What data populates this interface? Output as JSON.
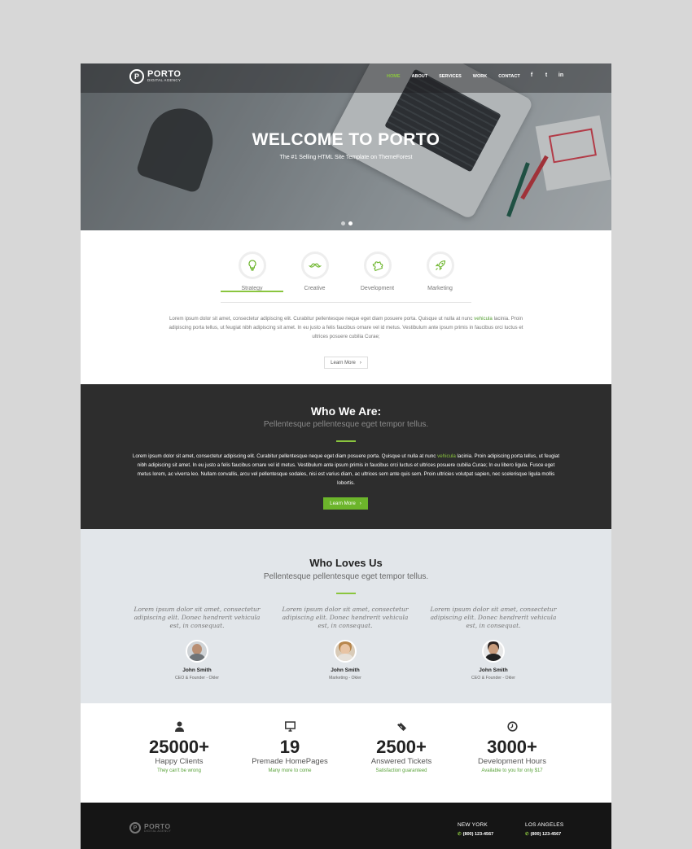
{
  "brand": {
    "name": "PORTO",
    "tagline": "DIGITAL AGENCY",
    "logo_letter": "P"
  },
  "nav": {
    "items": [
      {
        "label": "HOME",
        "active": true
      },
      {
        "label": "ABOUT",
        "active": false
      },
      {
        "label": "SERVICES",
        "active": false
      },
      {
        "label": "WORK",
        "active": false
      },
      {
        "label": "CONTACT",
        "active": false
      }
    ],
    "socials": [
      {
        "icon": "facebook-icon",
        "glyph": "f"
      },
      {
        "icon": "twitter-icon",
        "glyph": "t"
      },
      {
        "icon": "linkedin-icon",
        "glyph": "in"
      }
    ]
  },
  "hero": {
    "title": "WELCOME TO PORTO",
    "subtitle": "The #1 Selling HTML Site Template on ThemeForest"
  },
  "features": {
    "tabs": [
      {
        "label": "Strategy",
        "icon": "lightbulb-icon",
        "active": true
      },
      {
        "label": "Creative",
        "icon": "mustache-icon",
        "active": false
      },
      {
        "label": "Development",
        "icon": "puzzle-icon",
        "active": false
      },
      {
        "label": "Marketing",
        "icon": "rocket-icon",
        "active": false
      }
    ],
    "text_before": "Lorem ipsum dolor sit amet, consectetur adipiscing elit. Curabitur pellentesque neque eget diam posuere porta. Quisque ut nulla at nunc ",
    "link": "vehicula",
    "text_after": " lacinia. Proin adipiscing porta tellus, ut feugiat nibh adipiscing sit amet. In eu justo a felis faucibus ornare vel id metus. Vestibulum ante ipsum primis in faucibus orci luctus et ultrices posuere cubilia Curae;",
    "button": "Learn More",
    "button_arrow": "›"
  },
  "who_we_are": {
    "title": "Who We Are:",
    "subtitle": "Pellentesque pellentesque eget tempor tellus.",
    "text_before": "Lorem ipsum dolor sit amet, consectetur adipiscing elit. Curabitur pellentesque neque eget diam posuere porta. Quisque ut nulla at nunc ",
    "link": "vehicula",
    "text_after": " lacinia. Proin adipiscing porta tellus, ut feugiat nibh adipiscing sit amet. In eu justo a felis faucibus ornare vel id metus. Vestibulum ante ipsum primis in faucibus orci luctus et ultrices posuere cubilia Curae; In eu libero ligula. Fusce eget metus lorem, ac viverra leo. Nullam convallis, arcu vel pellentesque sodales, nisi est varius diam, ac ultrices sem ante quis sem. Proin ultricies volutpat sapien, nec scelerisque ligula mollis lobortis.",
    "button": "Learn More",
    "button_arrow": "›"
  },
  "who_loves_us": {
    "title": "Who Loves Us",
    "subtitle": "Pellentesque pellentesque eget tempor tellus.",
    "testimonials": [
      {
        "quote": "Lorem ipsum dolor sit amet, consectetur adipiscing elit. Donec hendrerit vehicula est, in consequat.",
        "name": "John Smith",
        "role": "CEO & Founder - Okler"
      },
      {
        "quote": "Lorem ipsum dolor sit amet, consectetur adipiscing elit. Donec hendrerit vehicula est, in consequat.",
        "name": "John Smith",
        "role": "Marketing - Okler"
      },
      {
        "quote": "Lorem ipsum dolor sit amet, consectetur adipiscing elit. Donec hendrerit vehicula est, in consequat.",
        "name": "John Smith",
        "role": "CEO & Founder - Okler"
      }
    ]
  },
  "counters": [
    {
      "icon": "user-icon",
      "number": "25000+",
      "label": "Happy Clients",
      "sub": "They can't be wrong"
    },
    {
      "icon": "monitor-icon",
      "number": "19",
      "label": "Premade HomePages",
      "sub": "Many more to come"
    },
    {
      "icon": "ticket-icon",
      "number": "2500+",
      "label": "Answered Tickets",
      "sub": "Satisfaction guaranteed"
    },
    {
      "icon": "clock-icon",
      "number": "3000+",
      "label": "Development Hours",
      "sub": "Available to you for only $17"
    }
  ],
  "footer": {
    "offices": [
      {
        "city": "NEW YORK",
        "phone": "(800) 123-4567"
      },
      {
        "city": "LOS ANGELES",
        "phone": "(800) 123-4567"
      }
    ]
  },
  "colors": {
    "accent": "#8ac53e",
    "button_green": "#6cb52b",
    "dark": "#2d2d2d",
    "light_section": "#e2e6ea",
    "footer": "#151515"
  }
}
